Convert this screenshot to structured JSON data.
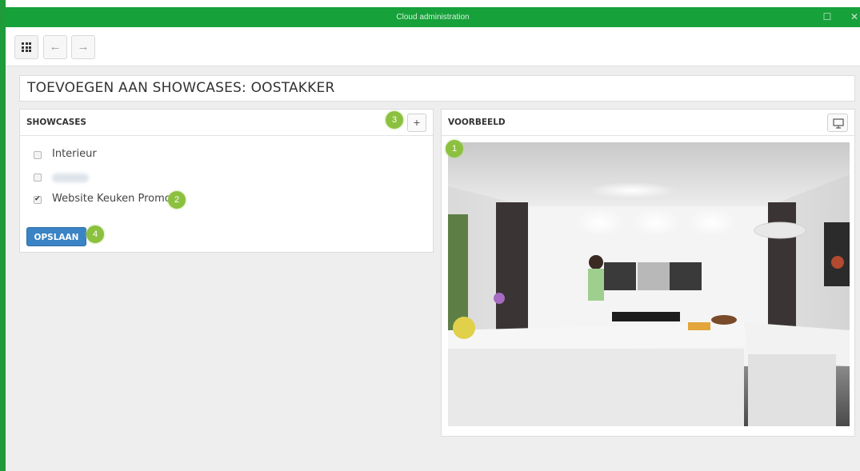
{
  "window": {
    "title": "Cloud  administration",
    "maximize_glyph": "☐",
    "close_glyph": "✕"
  },
  "toolbar": {
    "apps_icon": "grid-icon",
    "back_glyph": "←",
    "forward_glyph": "→"
  },
  "page": {
    "title": "TOEVOEGEN AAN SHOWCASES: OOSTAKKER"
  },
  "showcases": {
    "header": "SHOWCASES",
    "add_glyph": "+",
    "items": [
      {
        "label": "Interieur",
        "checked": false
      },
      {
        "label": "",
        "checked": false,
        "blurred": true
      },
      {
        "label": "Website Keuken Promo",
        "checked": true
      }
    ],
    "save_label": "OPSLAAN"
  },
  "preview": {
    "header": "VOORBEELD",
    "monitor_icon": "monitor-icon"
  },
  "markers": [
    "1",
    "2",
    "3",
    "4"
  ],
  "colors": {
    "titlebar": "#16a13a",
    "primary_button": "#3a83c4",
    "marker": "#8cc03f"
  }
}
